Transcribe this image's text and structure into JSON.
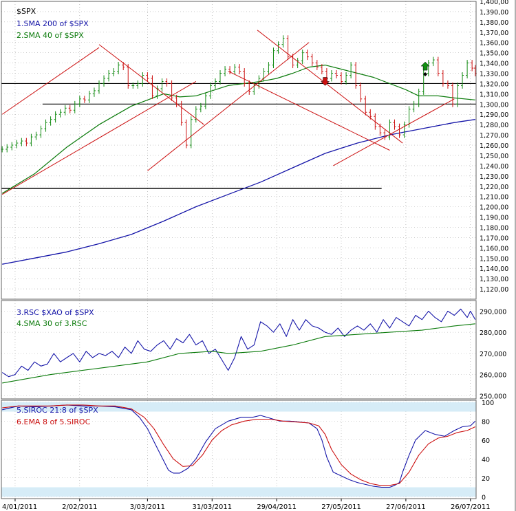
{
  "chart_data": [
    {
      "type": "line",
      "panel": "price",
      "title": "$SPX",
      "legend": [
        {
          "label": "1.SMA 200  of $SPX",
          "color": "#1515a8"
        },
        {
          "label": "2.SMA 40  of $SPX",
          "color": "#0a7a0a"
        }
      ],
      "ylim": [
        1110,
        1400
      ],
      "y_ticks": [
        "1,400,00",
        "1,390,00",
        "1,380,00",
        "1,370,00",
        "1,360,00",
        "1,350,00",
        "1,340,00",
        "1,330,00",
        "1,320,00",
        "1,310,00",
        "1,300,00",
        "1,290,00",
        "1,280,00",
        "1,270,00",
        "1,260,00",
        "1,250,00",
        "1,240,00",
        "1,230,00",
        "1,220,00",
        "1,210,00",
        "1,200,00",
        "1,190,00",
        "1,180,00",
        "1,170,00",
        "1,160,00",
        "1,150,00",
        "1,140,00",
        "1,130,00",
        "1,120,00"
      ],
      "price_close": [
        [
          0,
          1256
        ],
        [
          3,
          1258
        ],
        [
          6,
          1260
        ],
        [
          9,
          1262
        ],
        [
          12,
          1264
        ],
        [
          15,
          1262
        ],
        [
          18,
          1268
        ],
        [
          21,
          1270
        ],
        [
          24,
          1276
        ],
        [
          27,
          1282
        ],
        [
          30,
          1285
        ],
        [
          33,
          1290
        ],
        [
          36,
          1292
        ],
        [
          39,
          1296
        ],
        [
          42,
          1294
        ],
        [
          45,
          1300
        ],
        [
          48,
          1305
        ],
        [
          51,
          1304
        ],
        [
          54,
          1310
        ],
        [
          57,
          1313
        ],
        [
          60,
          1320
        ],
        [
          63,
          1325
        ],
        [
          66,
          1330
        ],
        [
          69,
          1332
        ],
        [
          72,
          1338
        ],
        [
          75,
          1336
        ],
        [
          78,
          1318
        ],
        [
          81,
          1318
        ],
        [
          84,
          1320
        ],
        [
          87,
          1328
        ],
        [
          90,
          1325
        ],
        [
          93,
          1308
        ],
        [
          96,
          1315
        ],
        [
          99,
          1322
        ],
        [
          102,
          1320
        ],
        [
          105,
          1306
        ],
        [
          108,
          1300
        ],
        [
          111,
          1282
        ],
        [
          114,
          1260
        ],
        [
          117,
          1285
        ],
        [
          120,
          1295
        ],
        [
          123,
          1298
        ],
        [
          126,
          1308
        ],
        [
          129,
          1318
        ],
        [
          132,
          1322
        ],
        [
          135,
          1330
        ],
        [
          138,
          1334
        ],
        [
          141,
          1332
        ],
        [
          144,
          1336
        ],
        [
          147,
          1332
        ],
        [
          150,
          1320
        ],
        [
          153,
          1312
        ],
        [
          156,
          1318
        ],
        [
          159,
          1325
        ],
        [
          162,
          1332
        ],
        [
          165,
          1338
        ],
        [
          168,
          1352
        ],
        [
          171,
          1358
        ],
        [
          174,
          1364
        ],
        [
          177,
          1346
        ],
        [
          180,
          1338
        ],
        [
          183,
          1342
        ],
        [
          186,
          1350
        ],
        [
          189,
          1346
        ],
        [
          192,
          1340
        ],
        [
          195,
          1336
        ],
        [
          198,
          1332
        ],
        [
          201,
          1325
        ],
        [
          204,
          1330
        ],
        [
          207,
          1328
        ],
        [
          210,
          1322
        ],
        [
          213,
          1328
        ],
        [
          216,
          1338
        ],
        [
          219,
          1318
        ],
        [
          222,
          1305
        ],
        [
          225,
          1292
        ],
        [
          228,
          1288
        ],
        [
          231,
          1278
        ],
        [
          234,
          1272
        ],
        [
          237,
          1268
        ],
        [
          240,
          1282
        ],
        [
          243,
          1278
        ],
        [
          246,
          1270
        ],
        [
          249,
          1280
        ],
        [
          252,
          1295
        ],
        [
          255,
          1300
        ],
        [
          258,
          1312
        ],
        [
          261,
          1330
        ],
        [
          264,
          1340
        ],
        [
          267,
          1343
        ],
        [
          270,
          1330
        ],
        [
          273,
          1320
        ],
        [
          276,
          1318
        ],
        [
          279,
          1300
        ],
        [
          282,
          1318
        ],
        [
          285,
          1328
        ],
        [
          288,
          1340
        ],
        [
          291,
          1335
        ],
        [
          293,
          1330
        ]
      ],
      "sma200": [
        [
          0,
          1144
        ],
        [
          20,
          1150
        ],
        [
          40,
          1156
        ],
        [
          60,
          1164
        ],
        [
          80,
          1173
        ],
        [
          100,
          1186
        ],
        [
          120,
          1200
        ],
        [
          140,
          1212
        ],
        [
          160,
          1224
        ],
        [
          180,
          1238
        ],
        [
          200,
          1252
        ],
        [
          220,
          1262
        ],
        [
          240,
          1270
        ],
        [
          260,
          1276
        ],
        [
          280,
          1282
        ],
        [
          293,
          1285
        ]
      ],
      "sma40": [
        [
          0,
          1213
        ],
        [
          20,
          1232
        ],
        [
          40,
          1258
        ],
        [
          60,
          1280
        ],
        [
          80,
          1298
        ],
        [
          100,
          1310
        ],
        [
          110,
          1307
        ],
        [
          120,
          1308
        ],
        [
          130,
          1313
        ],
        [
          140,
          1318
        ],
        [
          150,
          1320
        ],
        [
          160,
          1322
        ],
        [
          170,
          1325
        ],
        [
          180,
          1330
        ],
        [
          190,
          1336
        ],
        [
          200,
          1338
        ],
        [
          210,
          1334
        ],
        [
          220,
          1330
        ],
        [
          230,
          1326
        ],
        [
          240,
          1320
        ],
        [
          250,
          1314
        ],
        [
          258,
          1308
        ],
        [
          270,
          1308
        ],
        [
          280,
          1306
        ],
        [
          293,
          1304
        ]
      ],
      "hlines": [
        1320,
        1300,
        1218
      ],
      "red_trendlines": [
        [
          [
            0,
            1290
          ],
          [
            60,
            1355
          ]
        ],
        [
          [
            0,
            1212
          ],
          [
            120,
            1322
          ]
        ],
        [
          [
            60,
            1358
          ],
          [
            125,
            1280
          ]
        ],
        [
          [
            90,
            1235
          ],
          [
            190,
            1360
          ]
        ],
        [
          [
            158,
            1372
          ],
          [
            248,
            1262
          ]
        ],
        [
          [
            140,
            1332
          ],
          [
            240,
            1255
          ]
        ],
        [
          [
            205,
            1240
          ],
          [
            280,
            1305
          ]
        ]
      ],
      "arrows": [
        {
          "x": 200,
          "y": 1322,
          "dir": "down",
          "color": "#cc1010"
        },
        {
          "x": 262,
          "y": 1337,
          "dir": "up",
          "color": "#109010"
        }
      ],
      "x_tick_labels": [
        "4/01/2011",
        "2/02/2011",
        "3/03/2011",
        "31/03/2011",
        "29/04/2011",
        "27/05/2011",
        "27/06/2011",
        "26/07/2011"
      ]
    },
    {
      "type": "line",
      "panel": "rsc",
      "legend": [
        {
          "label": "3.RSC  $XAO of $SPX",
          "color": "#1515a8"
        },
        {
          "label": "4.SMA 30  of 3.RSC",
          "color": "#0a7a0a"
        }
      ],
      "ylim": [
        248500,
        295000
      ],
      "y_ticks": [
        "290,000",
        "280,000",
        "270,000",
        "260,000",
        "250,000"
      ],
      "rsc": [
        [
          0,
          261
        ],
        [
          4,
          259
        ],
        [
          8,
          260
        ],
        [
          12,
          264
        ],
        [
          16,
          262
        ],
        [
          20,
          266
        ],
        [
          24,
          264
        ],
        [
          28,
          265
        ],
        [
          32,
          270
        ],
        [
          36,
          266
        ],
        [
          40,
          268
        ],
        [
          44,
          270
        ],
        [
          48,
          266
        ],
        [
          52,
          271
        ],
        [
          56,
          268
        ],
        [
          60,
          270
        ],
        [
          64,
          269
        ],
        [
          68,
          271
        ],
        [
          72,
          268
        ],
        [
          76,
          273
        ],
        [
          80,
          270
        ],
        [
          84,
          276
        ],
        [
          88,
          272
        ],
        [
          92,
          271
        ],
        [
          96,
          274
        ],
        [
          100,
          276
        ],
        [
          104,
          272
        ],
        [
          108,
          277
        ],
        [
          112,
          275
        ],
        [
          116,
          279
        ],
        [
          120,
          274
        ],
        [
          124,
          276
        ],
        [
          128,
          270
        ],
        [
          132,
          272
        ],
        [
          136,
          267
        ],
        [
          140,
          262
        ],
        [
          144,
          268
        ],
        [
          148,
          278
        ],
        [
          152,
          272
        ],
        [
          156,
          274
        ],
        [
          160,
          285
        ],
        [
          164,
          283
        ],
        [
          168,
          280
        ],
        [
          172,
          284
        ],
        [
          176,
          278
        ],
        [
          180,
          286
        ],
        [
          184,
          281
        ],
        [
          188,
          286
        ],
        [
          192,
          283
        ],
        [
          196,
          282
        ],
        [
          200,
          280
        ],
        [
          204,
          279
        ],
        [
          208,
          282
        ],
        [
          212,
          278
        ],
        [
          216,
          281
        ],
        [
          220,
          283
        ],
        [
          224,
          281
        ],
        [
          228,
          284
        ],
        [
          232,
          280
        ],
        [
          236,
          286
        ],
        [
          240,
          282
        ],
        [
          244,
          287
        ],
        [
          248,
          285
        ],
        [
          252,
          283
        ],
        [
          256,
          288
        ],
        [
          260,
          286
        ],
        [
          264,
          290
        ],
        [
          268,
          287
        ],
        [
          272,
          285
        ],
        [
          276,
          290
        ],
        [
          280,
          288
        ],
        [
          284,
          291
        ],
        [
          288,
          287
        ],
        [
          290,
          290
        ],
        [
          293,
          286
        ]
      ],
      "sma30": [
        [
          0,
          256
        ],
        [
          30,
          260
        ],
        [
          60,
          263
        ],
        [
          90,
          266
        ],
        [
          110,
          270
        ],
        [
          130,
          271
        ],
        [
          140,
          270
        ],
        [
          160,
          271
        ],
        [
          180,
          274
        ],
        [
          200,
          278
        ],
        [
          220,
          279
        ],
        [
          240,
          280
        ],
        [
          260,
          281
        ],
        [
          280,
          283
        ],
        [
          293,
          284
        ]
      ]
    },
    {
      "type": "line",
      "panel": "siroc",
      "legend": [
        {
          "label": "5.SIROC 21:8  of $SPX",
          "color": "#1515a8"
        },
        {
          "label": "6.EMA 8  of 5.SIROC",
          "color": "#cc1010"
        }
      ],
      "ylim": [
        -2,
        102
      ],
      "y_ticks": [
        "100",
        "80",
        "60",
        "40",
        "20",
        "0"
      ],
      "bands": [
        [
          90,
          100
        ],
        [
          0,
          10
        ]
      ],
      "siroc": [
        [
          0,
          92
        ],
        [
          10,
          96
        ],
        [
          20,
          95
        ],
        [
          30,
          96
        ],
        [
          40,
          97
        ],
        [
          50,
          96
        ],
        [
          60,
          96
        ],
        [
          70,
          95
        ],
        [
          80,
          92
        ],
        [
          85,
          84
        ],
        [
          90,
          72
        ],
        [
          95,
          55
        ],
        [
          100,
          38
        ],
        [
          103,
          28
        ],
        [
          106,
          25
        ],
        [
          110,
          25
        ],
        [
          115,
          30
        ],
        [
          120,
          40
        ],
        [
          126,
          58
        ],
        [
          132,
          72
        ],
        [
          140,
          80
        ],
        [
          148,
          84
        ],
        [
          155,
          84
        ],
        [
          160,
          86
        ],
        [
          166,
          83
        ],
        [
          172,
          80
        ],
        [
          178,
          80
        ],
        [
          184,
          79
        ],
        [
          190,
          78
        ],
        [
          195,
          72
        ],
        [
          198,
          60
        ],
        [
          201,
          42
        ],
        [
          205,
          26
        ],
        [
          210,
          22
        ],
        [
          215,
          18
        ],
        [
          220,
          15
        ],
        [
          225,
          13
        ],
        [
          230,
          11
        ],
        [
          235,
          10
        ],
        [
          240,
          10
        ],
        [
          243,
          12
        ],
        [
          246,
          15
        ],
        [
          248,
          26
        ],
        [
          252,
          44
        ],
        [
          256,
          60
        ],
        [
          262,
          70
        ],
        [
          268,
          66
        ],
        [
          274,
          64
        ],
        [
          280,
          70
        ],
        [
          285,
          74
        ],
        [
          290,
          75
        ],
        [
          293,
          80
        ]
      ],
      "ema8": [
        [
          0,
          94
        ],
        [
          10,
          96
        ],
        [
          20,
          96
        ],
        [
          30,
          96
        ],
        [
          40,
          97
        ],
        [
          50,
          97
        ],
        [
          60,
          96
        ],
        [
          70,
          96
        ],
        [
          80,
          93
        ],
        [
          88,
          84
        ],
        [
          94,
          72
        ],
        [
          100,
          55
        ],
        [
          106,
          40
        ],
        [
          112,
          32
        ],
        [
          118,
          33
        ],
        [
          124,
          44
        ],
        [
          130,
          60
        ],
        [
          136,
          70
        ],
        [
          142,
          76
        ],
        [
          150,
          80
        ],
        [
          158,
          82
        ],
        [
          166,
          82
        ],
        [
          174,
          80
        ],
        [
          182,
          79
        ],
        [
          190,
          78
        ],
        [
          196,
          75
        ],
        [
          200,
          66
        ],
        [
          204,
          50
        ],
        [
          210,
          34
        ],
        [
          216,
          24
        ],
        [
          222,
          18
        ],
        [
          228,
          14
        ],
        [
          234,
          12
        ],
        [
          240,
          12
        ],
        [
          246,
          14
        ],
        [
          252,
          26
        ],
        [
          258,
          44
        ],
        [
          264,
          56
        ],
        [
          270,
          62
        ],
        [
          276,
          64
        ],
        [
          282,
          68
        ],
        [
          288,
          70
        ],
        [
          293,
          74
        ]
      ]
    }
  ]
}
